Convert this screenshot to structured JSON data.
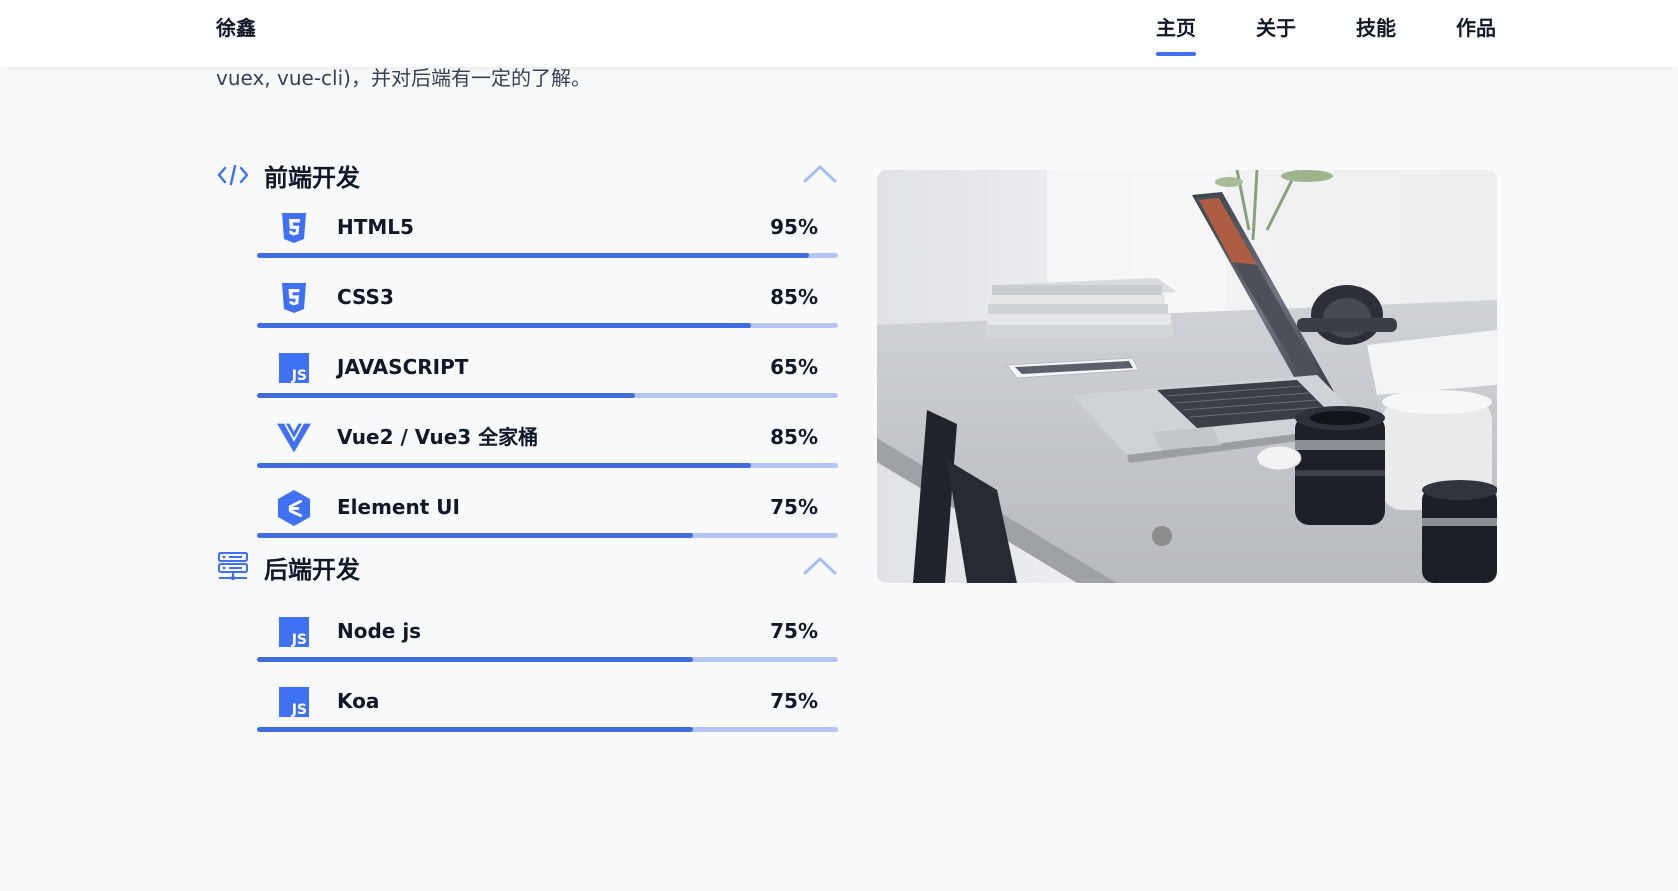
{
  "header": {
    "logo": "徐鑫",
    "nav": [
      {
        "label": "主页",
        "active": true
      },
      {
        "label": "关于",
        "active": false
      },
      {
        "label": "技能",
        "active": false
      },
      {
        "label": "作品",
        "active": false
      }
    ]
  },
  "intro_tail": "vuex, vue-cli)，并对后端有一定的了解。",
  "frontend": {
    "title": "前端开发",
    "icon": "code-icon",
    "skills": [
      {
        "name": "HTML5",
        "percent": "95%",
        "value": 0.95,
        "icon": "html5-icon"
      },
      {
        "name": "CSS3",
        "percent": "85%",
        "value": 0.85,
        "icon": "css3-icon"
      },
      {
        "name": "JAVASCRIPT",
        "percent": "65%",
        "value": 0.65,
        "icon": "javascript-icon"
      },
      {
        "name": "Vue2 / Vue3 全家桶",
        "percent": "85%",
        "value": 0.85,
        "icon": "vue-icon"
      },
      {
        "name": "Element UI",
        "percent": "75%",
        "value": 0.75,
        "icon": "element-ui-icon"
      }
    ]
  },
  "backend": {
    "title": "后端开发",
    "icon": "server-icon",
    "skills": [
      {
        "name": "Node js",
        "percent": "75%",
        "value": 0.75,
        "icon": "javascript-icon"
      },
      {
        "name": "Koa",
        "percent": "75%",
        "value": 0.75,
        "icon": "javascript-icon"
      }
    ]
  },
  "colors": {
    "accent": "#4070f4",
    "bar_fill": "#3f6de0",
    "bar_track": "#b6c6f4",
    "background": "#f8fafc"
  }
}
